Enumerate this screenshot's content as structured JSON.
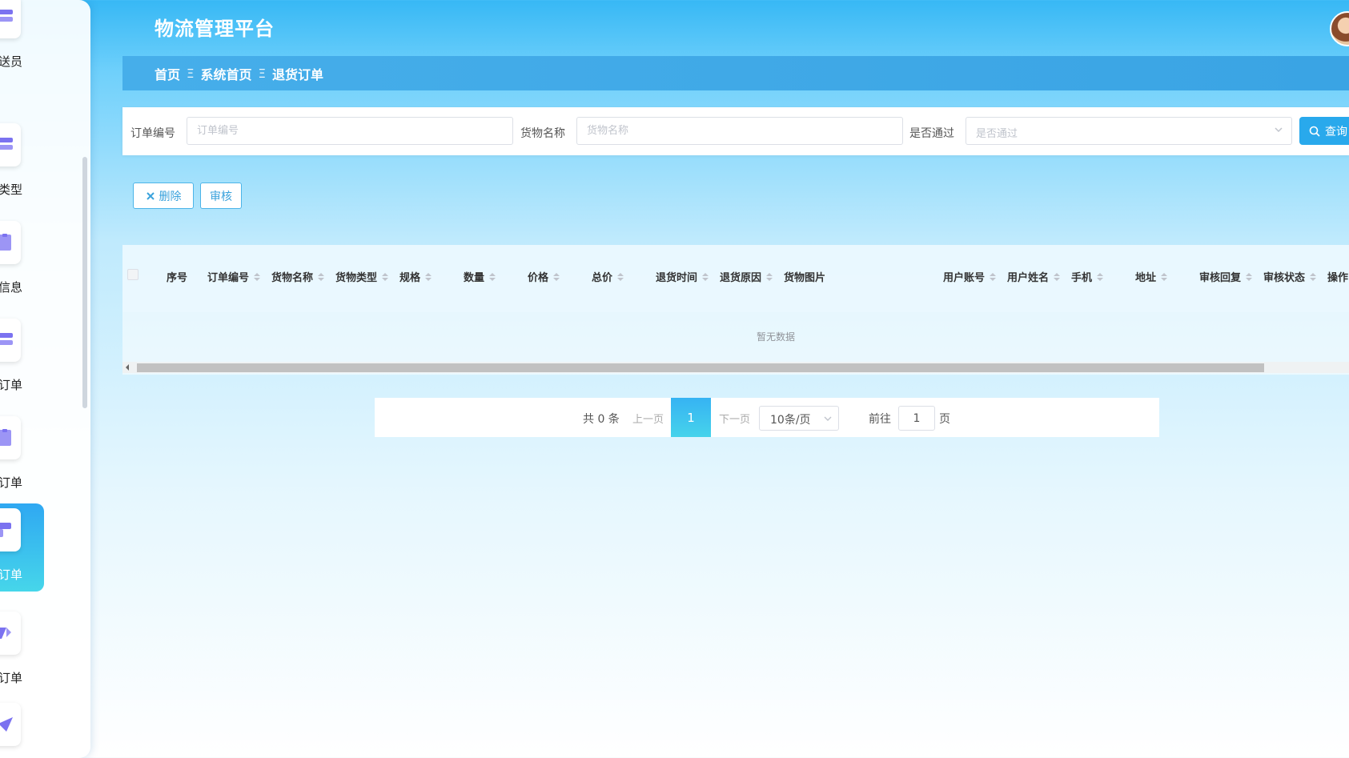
{
  "app": {
    "title": "物流管理平台"
  },
  "sidebar": {
    "items": [
      {
        "label": "送员",
        "icon": "menu-icon",
        "active": false
      },
      {
        "label": "类型",
        "icon": "menu-icon",
        "active": false
      },
      {
        "label": "信息",
        "icon": "document-icon",
        "active": false
      },
      {
        "label": "订单",
        "icon": "menu-icon",
        "active": false
      },
      {
        "label": "订单",
        "icon": "document-icon",
        "active": false
      },
      {
        "label": "订单",
        "icon": "flag-icon",
        "active": true
      },
      {
        "label": "订单",
        "icon": "tool-icon",
        "active": false
      },
      {
        "label": "",
        "icon": "send-icon",
        "active": false
      }
    ]
  },
  "breadcrumb": {
    "items": [
      "首页",
      "系统首页",
      "退货订单"
    ],
    "separator": "Ξ"
  },
  "search": {
    "order_no_label": "订单编号",
    "order_no_placeholder": "订单编号",
    "goods_name_label": "货物名称",
    "goods_name_placeholder": "货物名称",
    "passed_label": "是否通过",
    "passed_placeholder": "是否通过",
    "query_label": "查询"
  },
  "actions": {
    "delete_label": "删除",
    "review_label": "审核"
  },
  "table": {
    "columns": [
      "序号",
      "订单编号",
      "货物名称",
      "货物类型",
      "规格",
      "数量",
      "价格",
      "总价",
      "退货时间",
      "退货原因",
      "货物图片",
      "用户账号",
      "用户姓名",
      "手机",
      "地址",
      "审核回复",
      "审核状态",
      "操作"
    ],
    "empty_text": "暂无数据"
  },
  "pagination": {
    "total": "共 0 条",
    "prev": "上一页",
    "current_page": "1",
    "next": "下一页",
    "page_size": "10条/页",
    "goto_label": "前往",
    "goto_value": "1",
    "page_suffix": "页"
  },
  "colors": {
    "accent": "#29a9ec",
    "active_gradient_end": "#46d6ea",
    "header_bg": "#37b8f5"
  }
}
